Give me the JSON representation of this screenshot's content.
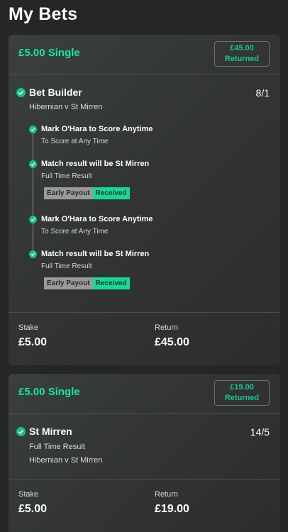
{
  "page": {
    "title": "My Bets"
  },
  "colors": {
    "accent": "#14e6a7",
    "check": "#13c38d",
    "background": "#262626",
    "card": "#333634"
  },
  "icons": {
    "check": "check-circle-icon"
  },
  "bets": [
    {
      "title": "£5.00 Single",
      "returned_amount": "£45.00",
      "returned_label": "Returned",
      "selection": {
        "title": "Bet Builder",
        "odds": "8/1",
        "event": "Hibernian v St Mirren"
      },
      "legs": [
        {
          "title": "Mark O'Hara to Score Anytime",
          "market": "To Score at Any Time",
          "tags": []
        },
        {
          "title": "Match result will be St Mirren",
          "market": "Full Time Result",
          "tags": [
            "Early Payout",
            "Received"
          ]
        },
        {
          "title": "Mark O'Hara to Score Anytime",
          "market": "To Score at Any Time",
          "tags": []
        },
        {
          "title": "Match result will be St Mirren",
          "market": "Full Time Result",
          "tags": [
            "Early Payout",
            "Received"
          ]
        }
      ],
      "stake_label": "Stake",
      "stake": "£5.00",
      "return_label": "Return",
      "return": "£45.00"
    },
    {
      "title": "£5.00 Single",
      "returned_amount": "£19.00",
      "returned_label": "Returned",
      "selection": {
        "title": "St Mirren",
        "odds": "14/5",
        "market": "Full Time Result",
        "event": "Hibernian v St Mirren"
      },
      "stake_label": "Stake",
      "stake": "£5.00",
      "return_label": "Return",
      "return": "£19.00"
    }
  ]
}
